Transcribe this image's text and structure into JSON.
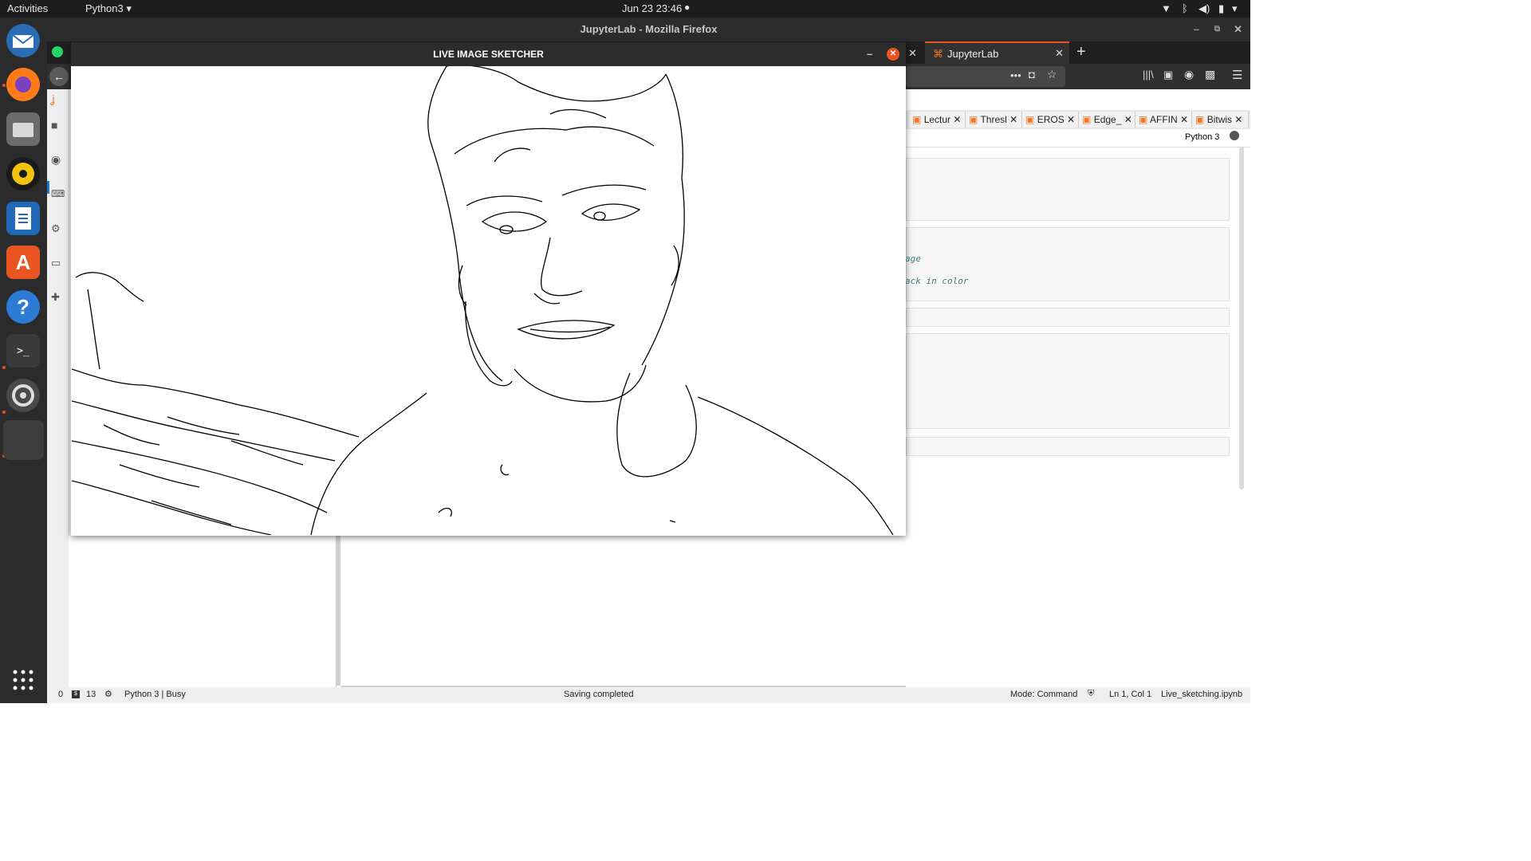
{
  "topbar": {
    "activities": "Activities",
    "app_menu": "Python3",
    "datetime": "Jun 23  23:46"
  },
  "firefox": {
    "window_title": "JupyterLab - Mozilla Firefox",
    "active_tab": "JupyterLab",
    "new_tab_symbol": "+"
  },
  "jupyter": {
    "doc_tabs": [
      "Lectur",
      "Thresl",
      "EROS",
      "Edge_",
      "AFFIN",
      "Bitwis"
    ],
    "kernel": "Python 3",
    "code_snippets": [
      "age",
      "ack in color"
    ],
    "status": {
      "left_a": "0",
      "left_b": "13",
      "kernel_state": "Python 3 | Busy",
      "center": "Saving completed",
      "mode": "Mode: Command",
      "position": "Ln 1, Col 1",
      "filename": "Live_sketching.ipynb"
    }
  },
  "cv_window": {
    "title": "LIVE IMAGE SKETCHER"
  },
  "icons": {
    "dock": [
      "thunderbird-icon",
      "firefox-icon",
      "files-icon",
      "rhythmbox-icon",
      "writer-icon",
      "software-center-icon",
      "help-icon",
      "terminal-icon",
      "settings-icon",
      "show-apps-icon"
    ]
  },
  "colors": {
    "ubuntu_orange": "#e95420",
    "close_red": "#e95420"
  }
}
